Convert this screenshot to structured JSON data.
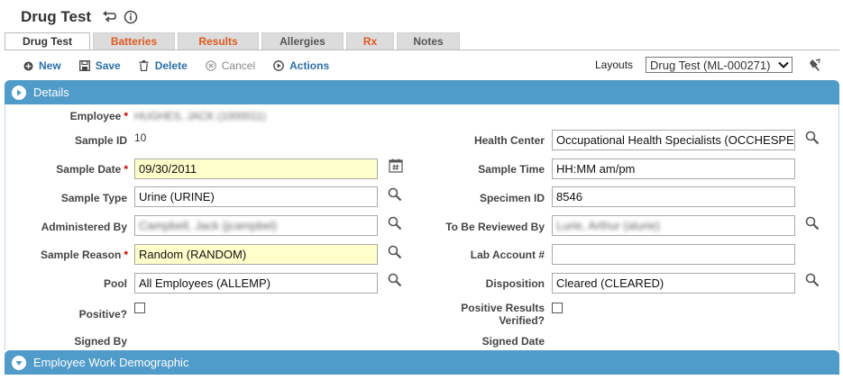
{
  "header": {
    "title": "Drug Test"
  },
  "tabs": [
    {
      "label": "Drug Test",
      "active": true
    },
    {
      "label": "Batteries"
    },
    {
      "label": "Results"
    },
    {
      "label": "Allergies"
    },
    {
      "label": "Rx"
    },
    {
      "label": "Notes"
    }
  ],
  "toolbar": {
    "new_label": "New",
    "save_label": "Save",
    "delete_label": "Delete",
    "cancel_label": "Cancel",
    "actions_label": "Actions"
  },
  "layouts": {
    "label": "Layouts",
    "selected": "Drug Test (ML-000271)"
  },
  "sections": {
    "details": "Details",
    "employee_work_demographic": "Employee Work Demographic"
  },
  "form": {
    "employee": {
      "label": "Employee",
      "value": "HUGHES, JACK (1000011)"
    },
    "sample_id": {
      "label": "Sample ID",
      "value": "10"
    },
    "sample_date": {
      "label": "Sample Date",
      "value": "09/30/2011"
    },
    "sample_type": {
      "label": "Sample Type",
      "value": "Urine (URINE)"
    },
    "administered_by": {
      "label": "Administered By",
      "value": "Campbell, Jack (jcampbel)"
    },
    "sample_reason": {
      "label": "Sample Reason",
      "value": "Random (RANDOM)"
    },
    "pool": {
      "label": "Pool",
      "value": "All Employees (ALLEMP)"
    },
    "positive": {
      "label": "Positive?"
    },
    "signed_by": {
      "label": "Signed By"
    },
    "health_center": {
      "label": "Health Center",
      "value": "Occupational Health Specialists (OCCHESPEC)"
    },
    "sample_time": {
      "label": "Sample Time",
      "value": "HH:MM am/pm"
    },
    "specimen_id": {
      "label": "Specimen ID",
      "value": "8546"
    },
    "to_be_reviewed_by": {
      "label": "To Be Reviewed By",
      "value": "Lurie, Arthur (alurie)"
    },
    "lab_account": {
      "label": "Lab Account #",
      "value": ""
    },
    "disposition": {
      "label": "Disposition",
      "value": "Cleared (CLEARED)"
    },
    "positive_results_verified": {
      "label_line1": "Positive Results",
      "label_line2": "Verified?"
    },
    "signed_date": {
      "label": "Signed Date"
    }
  },
  "colors": {
    "accent": "#4f9bc9",
    "link": "#2a6fa8",
    "tab_orange": "#e05a20",
    "required_bg": "#ffffcc"
  }
}
